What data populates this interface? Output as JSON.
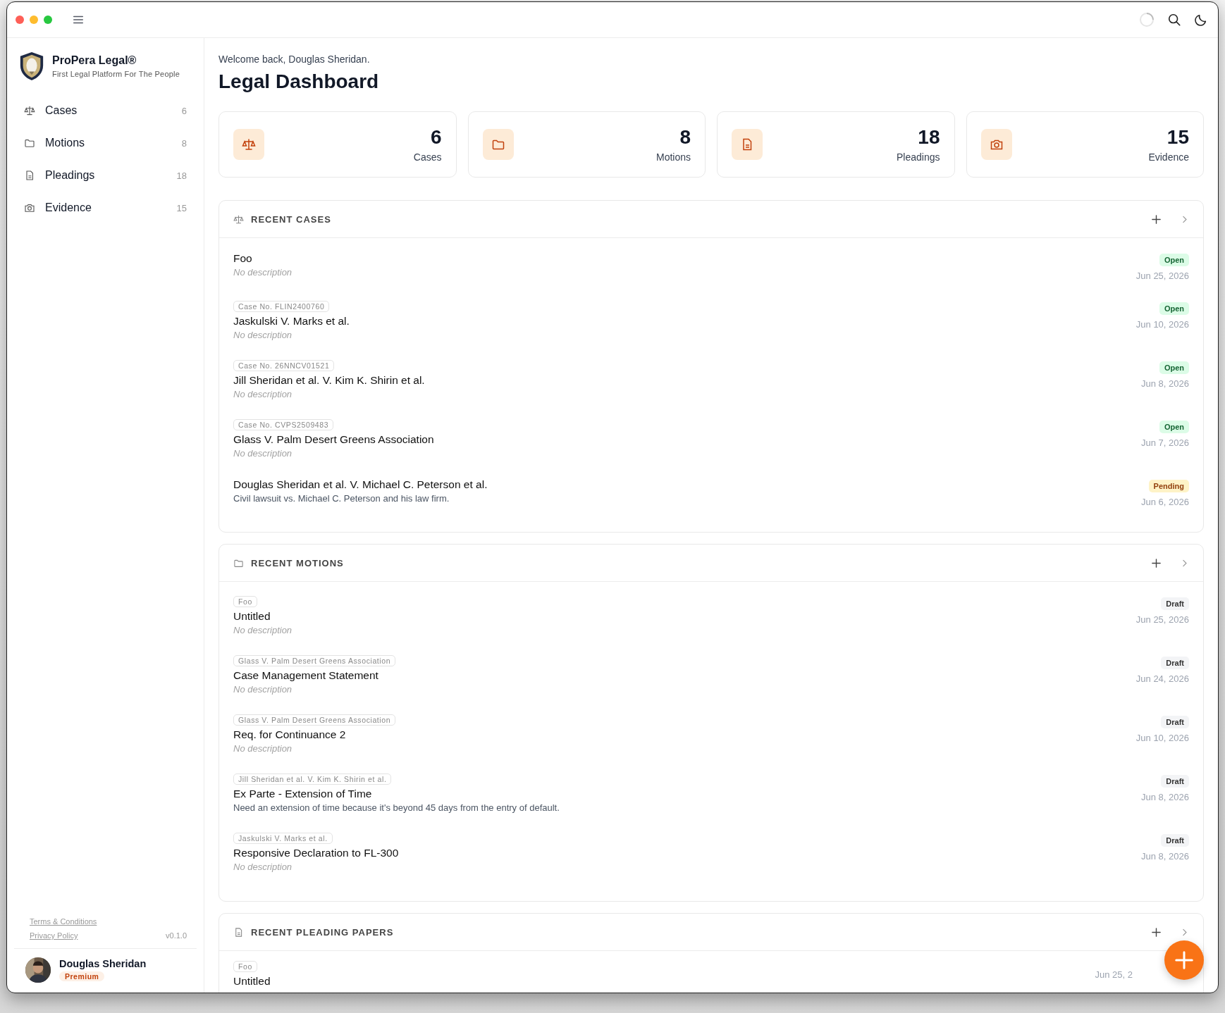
{
  "app": {
    "name": "ProPera Legal®",
    "tagline": "First Legal Platform For The People"
  },
  "sidebar": {
    "items": [
      {
        "label": "Cases",
        "count": "6"
      },
      {
        "label": "Motions",
        "count": "8"
      },
      {
        "label": "Pleadings",
        "count": "18"
      },
      {
        "label": "Evidence",
        "count": "15"
      }
    ],
    "links": [
      "Terms & Conditions",
      "Privacy Policy"
    ],
    "version": "v0.1.0",
    "user": {
      "name": "Douglas Sheridan",
      "plan": "Premium"
    }
  },
  "header": {
    "welcome": "Welcome back, Douglas Sheridan.",
    "title": "Legal Dashboard"
  },
  "stats": [
    {
      "value": "6",
      "label": "Cases"
    },
    {
      "value": "8",
      "label": "Motions"
    },
    {
      "value": "18",
      "label": "Pleadings"
    },
    {
      "value": "15",
      "label": "Evidence"
    }
  ],
  "sections": [
    {
      "title": "RECENT CASES",
      "rows": [
        {
          "title": "Foo",
          "description": "No description",
          "empty": true,
          "status": {
            "label": "Open",
            "kind": "open"
          },
          "date": "Jun 25, 2026"
        },
        {
          "tag": "Case No. FLIN2400760",
          "title": "Jaskulski V. Marks et al.",
          "description": "No description",
          "empty": true,
          "status": {
            "label": "Open",
            "kind": "open"
          },
          "date": "Jun 10, 2026"
        },
        {
          "tag": "Case No. 26NNCV01521",
          "title": "Jill Sheridan et al. V. Kim K. Shirin et al.",
          "description": "No description",
          "empty": true,
          "status": {
            "label": "Open",
            "kind": "open"
          },
          "date": "Jun 8, 2026"
        },
        {
          "tag": "Case No. CVPS2509483",
          "title": "Glass V. Palm Desert Greens Association",
          "description": "No description",
          "empty": true,
          "status": {
            "label": "Open",
            "kind": "open"
          },
          "date": "Jun 7, 2026"
        },
        {
          "title": "Douglas Sheridan et al. V. Michael C. Peterson et al.",
          "description": "Civil lawsuit vs. Michael C. Peterson and his law firm.",
          "empty": false,
          "status": {
            "label": "Pending",
            "kind": "pending"
          },
          "date": "Jun 6, 2026"
        }
      ]
    },
    {
      "title": "RECENT MOTIONS",
      "rows": [
        {
          "tag": "Foo",
          "title": "Untitled",
          "description": "No description",
          "empty": true,
          "status": {
            "label": "Draft",
            "kind": "draft"
          },
          "date": "Jun 25, 2026"
        },
        {
          "tag": "Glass V. Palm Desert Greens Association",
          "title": "Case Management Statement",
          "description": "No description",
          "empty": true,
          "status": {
            "label": "Draft",
            "kind": "draft"
          },
          "date": "Jun 24, 2026"
        },
        {
          "tag": "Glass V. Palm Desert Greens Association",
          "title": "Req. for Continuance 2",
          "description": "No description",
          "empty": true,
          "status": {
            "label": "Draft",
            "kind": "draft"
          },
          "date": "Jun 10, 2026"
        },
        {
          "tag": "Jill Sheridan et al. V. Kim K. Shirin et al.",
          "title": "Ex Parte - Extension of Time",
          "description": "Need an extension of time because it's beyond 45 days from the entry of default.",
          "empty": false,
          "status": {
            "label": "Draft",
            "kind": "draft"
          },
          "date": "Jun 8, 2026"
        },
        {
          "tag": "Jaskulski V. Marks et al.",
          "title": "Responsive Declaration to FL-300",
          "description": "No description",
          "empty": true,
          "status": {
            "label": "Draft",
            "kind": "draft"
          },
          "date": "Jun 8, 2026"
        }
      ]
    },
    {
      "title": "RECENT PLEADING PAPERS",
      "rows": [
        {
          "tag": "Foo",
          "title": "Untitled",
          "date": "Jun 25, 2"
        }
      ]
    }
  ]
}
